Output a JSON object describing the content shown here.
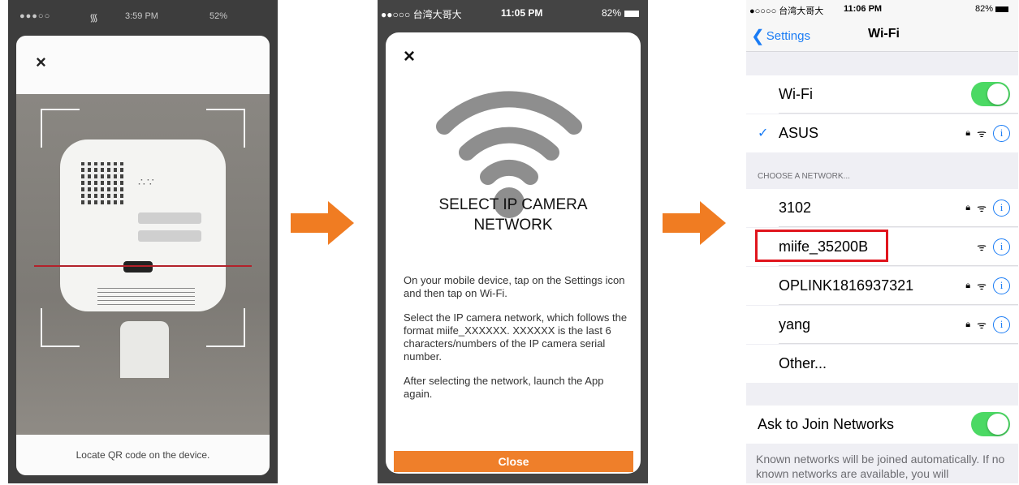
{
  "phone1": {
    "status_time": "3:59 PM",
    "status_battery": "52%",
    "close_label": "×",
    "hint": "Locate QR code on the device."
  },
  "phone2": {
    "status_carrier": "●●○○○ 台湾大哥大",
    "status_time": "11:05 PM",
    "status_battery": "82%",
    "close_label": "×",
    "title_line1": "SELECT IP CAMERA",
    "title_line2": "NETWORK",
    "paragraphs": [
      "On your mobile device, tap on the Settings icon and then tap on Wi-Fi.",
      "Select the IP camera network, which follows the format miife_XXXXXX. XXXXXX is the last 6 characters/numbers of the IP camera serial number.",
      "After selecting the network, launch the App again."
    ],
    "button_label": "Close",
    "accent_color": "#ef7f2a"
  },
  "phone3": {
    "status_carrier": "●○○○○ 台湾大哥大",
    "status_time": "11:06 PM",
    "status_battery": "82%",
    "back_label": "Settings",
    "title": "Wi-Fi",
    "wifi_label": "Wi-Fi",
    "wifi_on": true,
    "connected_network": "ASUS",
    "section_header": "CHOOSE A NETWORK...",
    "networks": [
      {
        "name": "3102",
        "locked": true
      },
      {
        "name": "miife_35200B",
        "locked": false
      },
      {
        "name": "OPLINK1816937321",
        "locked": true
      },
      {
        "name": "yang",
        "locked": true
      }
    ],
    "other_label": "Other...",
    "ask_label": "Ask to Join Networks",
    "ask_on": true,
    "footnote": "Known networks will be joined automatically. If no known networks are available, you will",
    "highlight_color": "#e0151d",
    "link_color": "#1a7cf5",
    "toggle_color": "#4cd964"
  },
  "arrow_color": "#f07c22"
}
